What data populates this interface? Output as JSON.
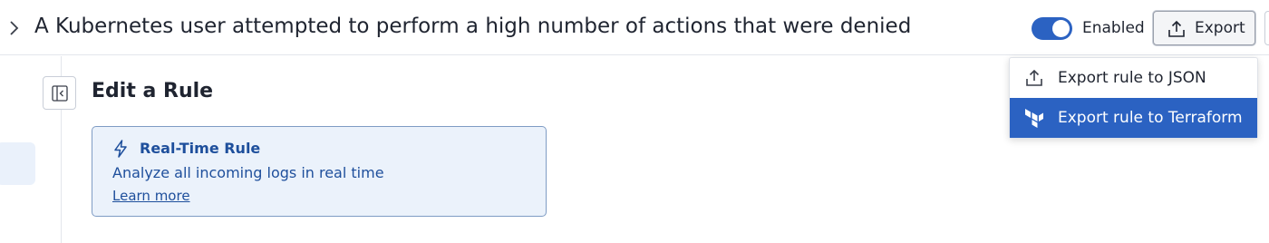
{
  "header": {
    "rule_title": "A Kubernetes user attempted to perform a high number of actions that were denied",
    "toggle": {
      "state": "on",
      "label": "Enabled"
    },
    "export_button": {
      "label": "Export"
    }
  },
  "main": {
    "section_title": "Edit a Rule",
    "info_card": {
      "title": "Real-Time Rule",
      "description": "Analyze all incoming logs in real time",
      "link": "Learn more"
    }
  },
  "export_menu": {
    "items": [
      {
        "label": "Export rule to JSON",
        "icon": "upload-icon",
        "highlighted": false
      },
      {
        "label": "Export rule to Terraform",
        "icon": "terraform-icon",
        "highlighted": true
      }
    ]
  },
  "colors": {
    "accent": "#2b62c2",
    "info_card_bg": "#ebf2fb",
    "info_card_text": "#1e4f9c"
  }
}
